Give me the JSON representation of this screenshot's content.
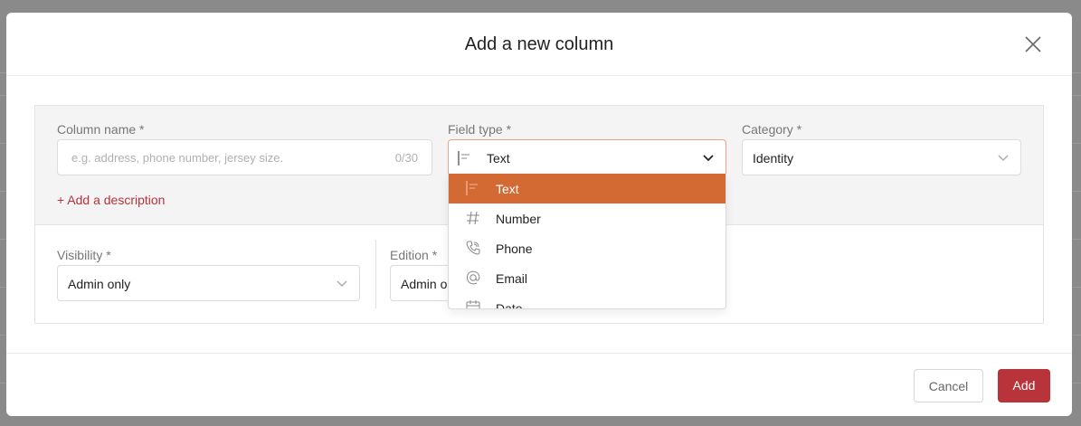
{
  "modal": {
    "title": "Add a new column",
    "close_icon": "close-icon"
  },
  "form": {
    "column_name": {
      "label": "Column name *",
      "placeholder": "e.g. address, phone number, jersey size.",
      "counter": "0/30"
    },
    "field_type": {
      "label": "Field type *",
      "value": "Text",
      "icon": "text-align-icon"
    },
    "category": {
      "label": "Category *",
      "value": "Identity"
    },
    "add_description": "+ Add a description",
    "visibility": {
      "label": "Visibility *",
      "value": "Admin only"
    },
    "edition": {
      "label": "Edition *",
      "value": "Admin o"
    }
  },
  "dropdown": {
    "options": [
      {
        "label": "Text",
        "icon": "text-align-icon",
        "selected": true
      },
      {
        "label": "Number",
        "icon": "hash-icon",
        "selected": false
      },
      {
        "label": "Phone",
        "icon": "phone-icon",
        "selected": false
      },
      {
        "label": "Email",
        "icon": "at-icon",
        "selected": false
      },
      {
        "label": "Date",
        "icon": "calendar-icon",
        "selected": false
      }
    ]
  },
  "footer": {
    "cancel_label": "Cancel",
    "add_label": "Add"
  },
  "colors": {
    "accent": "#b8333a",
    "selected_option": "#d36a33",
    "panel_bg": "#f4f4f4"
  }
}
